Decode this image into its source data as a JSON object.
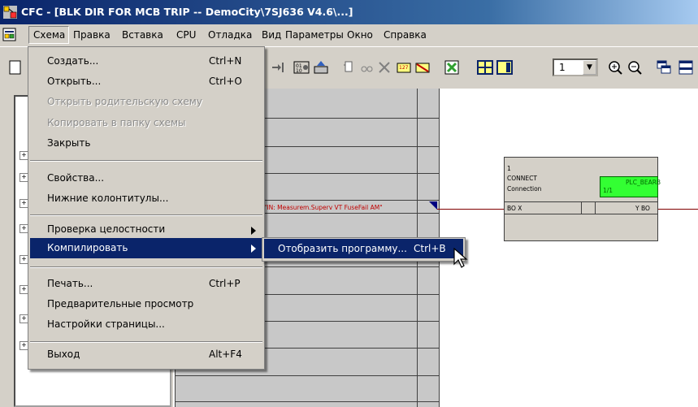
{
  "window": {
    "title": "CFC - [BLK DIR FOR MCB TRIP -- DemoCity\\7SJ636 V4.6\\...]"
  },
  "menubar": {
    "items": [
      "Схема",
      "Правка",
      "Вставка",
      "CPU",
      "Отладка",
      "Вид",
      "Параметры",
      "Окно",
      "Справка"
    ]
  },
  "toolbar": {
    "zoom_value": "1"
  },
  "schema_menu": {
    "items": [
      {
        "label": "Создать...",
        "shortcut": "Ctrl+N"
      },
      {
        "label": "Открыть...",
        "shortcut": "Ctrl+O"
      },
      {
        "label": "Открыть родительскую схему",
        "shortcut": ""
      },
      {
        "label": "Копировать в папку схемы",
        "shortcut": ""
      },
      {
        "label": "Закрыть",
        "shortcut": ""
      },
      {
        "label": "Свойства...",
        "shortcut": ""
      },
      {
        "label": "Нижние колонтитулы...",
        "shortcut": ""
      },
      {
        "label": "Проверка целостности",
        "shortcut": ""
      },
      {
        "label": "Компилировать",
        "shortcut": ""
      },
      {
        "label": "Печать...",
        "shortcut": "Ctrl+P"
      },
      {
        "label": "Предварительные просмотр",
        "shortcut": ""
      },
      {
        "label": "Настройки страницы...",
        "shortcut": ""
      },
      {
        "label": "Выход",
        "shortcut": "Alt+F4"
      }
    ]
  },
  "submenu": {
    "label": "Отобразить программу...",
    "shortcut": "Ctrl+B"
  },
  "sheet": {
    "signal_text": "\"IN: Measurem.Superv VT FuseFail AM\"",
    "block": {
      "number": "1",
      "type": "CONNECT",
      "name": "Connection",
      "input_port": "BO X",
      "output_port": "Y BO",
      "tag_name": "PLC_BEARB",
      "tag_index": "1/1"
    }
  },
  "colors": {
    "title_blue": "#0a246a",
    "highlight": "#0a246a",
    "block_green": "#33ff33",
    "signal_red": "#c00000"
  }
}
